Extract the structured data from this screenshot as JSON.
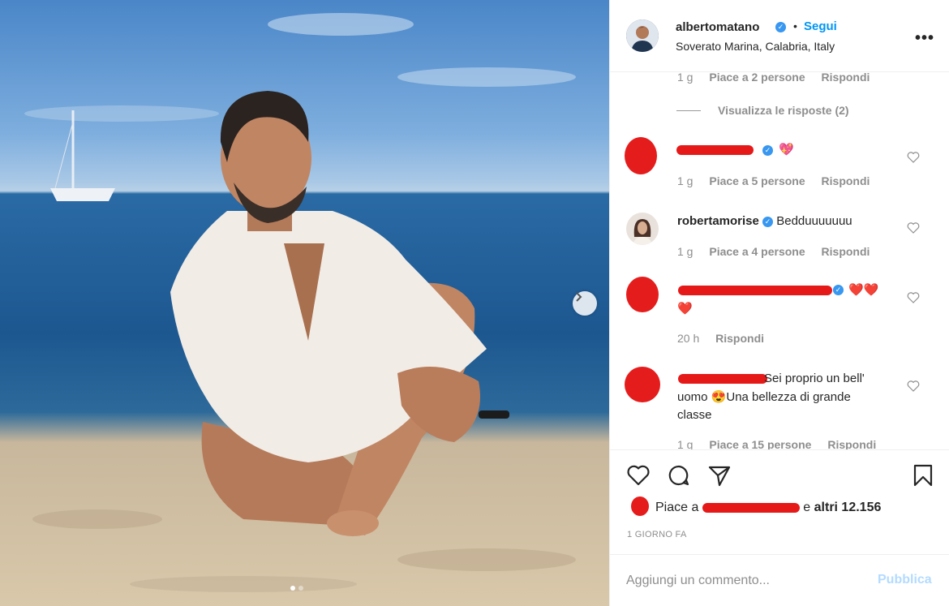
{
  "post": {
    "username": "albertomatano",
    "follow_label": "Segui",
    "separator": "•",
    "location": "Soverato Marina, Calabria, Italy",
    "more_icon": "more-horizontal-icon",
    "more_label": "•••"
  },
  "comments": {
    "first_meta": {
      "time": "1 g",
      "likes": "Piace a 2 persone",
      "reply": "Rispondi"
    },
    "view_replies": "Visualizza le risposte (2)",
    "items": [
      {
        "text": "💖",
        "meta": {
          "time": "1 g",
          "likes": "Piace a 5 persone",
          "reply": "Rispondi"
        }
      },
      {
        "user": "robertamorise",
        "text": "Bedduuuuuuu",
        "meta": {
          "time": "1 g",
          "likes": "Piace a 4 persone",
          "reply": "Rispondi"
        }
      },
      {
        "text": "❤️❤️",
        "text2": "❤️",
        "meta": {
          "time": "20 h",
          "reply": "Rispondi"
        }
      },
      {
        "text_line1": "Sei proprio un bell'",
        "text_line2": "uomo 😍Una bellezza di grande",
        "text_line3": "classe",
        "meta": {
          "time": "1 g",
          "likes": "Piace a 15 persone",
          "reply": "Rispondi"
        }
      }
    ]
  },
  "actions": {
    "like_icon": "heart-icon",
    "comment_icon": "comment-icon",
    "share_icon": "share-icon",
    "save_icon": "bookmark-icon"
  },
  "likes": {
    "prefix": "Piace a",
    "suffix": "e",
    "others": "altri 12.156"
  },
  "date": "1 GIORNO FA",
  "add_comment": {
    "placeholder": "Aggiungi un commento...",
    "publish": "Pubblica"
  },
  "carousel": {
    "next_icon": "chevron-right-icon"
  },
  "colors": {
    "accent": "#0095f6",
    "verified": "#3897f0",
    "redaction": "#e51c1c"
  }
}
